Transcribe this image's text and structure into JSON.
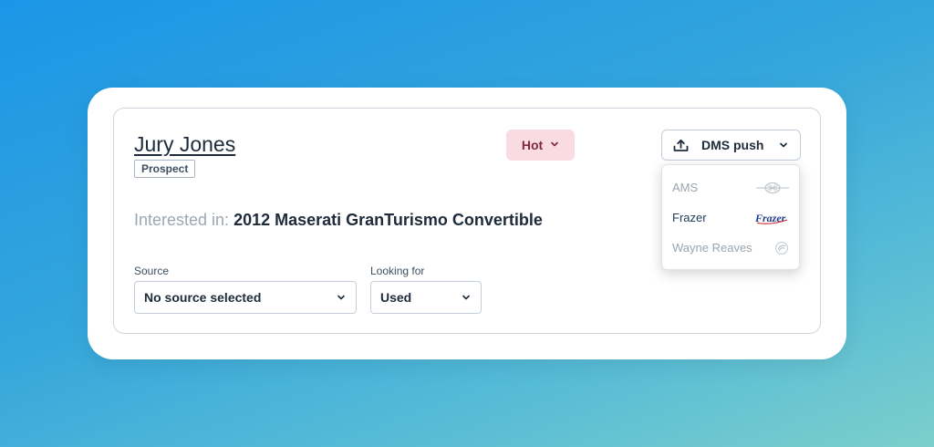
{
  "lead": {
    "name": "Jury Jones",
    "status_tag": "Prospect",
    "interested_label": "Interested in:",
    "vehicle": "2012 Maserati GranTurismo Convertible"
  },
  "temperature": {
    "label": "Hot",
    "color": "#f9dbe2"
  },
  "dms_push": {
    "label": "DMS push",
    "options": [
      {
        "label": "AMS",
        "logo_icon": "ams-logo-icon",
        "enabled": false
      },
      {
        "label": "Frazer",
        "logo_text": "Frazer",
        "logo_icon": "frazer-logo-icon",
        "enabled": true
      },
      {
        "label": "Wayne Reaves",
        "logo_icon": "wayne-reaves-logo-icon",
        "enabled": false
      }
    ]
  },
  "source": {
    "label": "Source",
    "value": "No source selected"
  },
  "looking_for": {
    "label": "Looking for",
    "value": "Used"
  }
}
